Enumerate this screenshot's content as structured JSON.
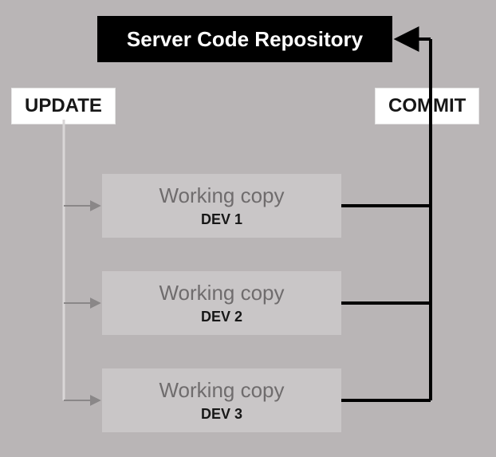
{
  "server": {
    "title": "Server Code Repository"
  },
  "labels": {
    "update": "UPDATE",
    "commit": "COMMIT"
  },
  "wc": {
    "title1": "Working copy",
    "title2": "Working copy",
    "title3": "Working copy",
    "dev1": "DEV 1",
    "dev2": "DEV 2",
    "dev3": "DEV 3"
  },
  "colors": {
    "bg": "#b9b5b6",
    "boxbg": "#c9c6c7",
    "muted": "#6f6c6d"
  }
}
